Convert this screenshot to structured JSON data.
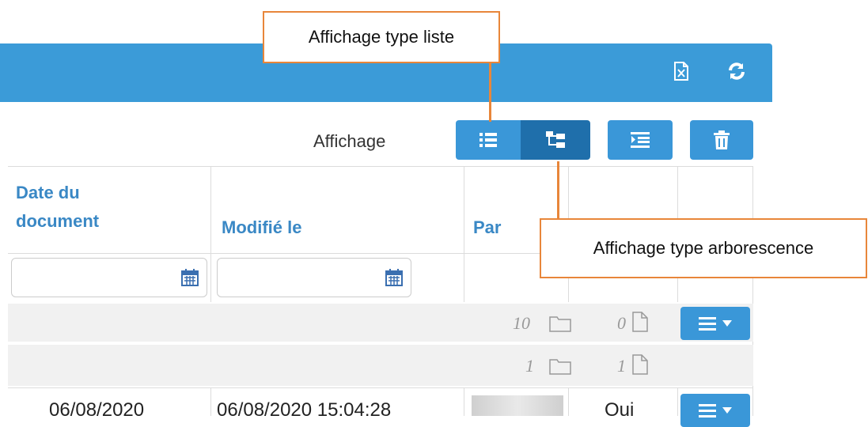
{
  "toolbar": {
    "display_label": "Affichage"
  },
  "header_icons": [
    "export-excel-icon",
    "refresh-icon"
  ],
  "columns": {
    "date_document": "Date du\ndocument",
    "modified": "Modifié le",
    "by": "Par"
  },
  "group_rows": [
    {
      "folders": "10",
      "files": "0"
    },
    {
      "folders": "1",
      "files": "1"
    }
  ],
  "row": {
    "date_document": "06/08/2020",
    "modified": "06/08/2020 15:04:28",
    "flag": "Oui"
  },
  "callouts": {
    "list_view": "Affichage type liste",
    "tree_view": "Affichage type arborescence"
  },
  "colors": {
    "header": "#3b9bd8",
    "button": "#3a97d8",
    "button_active": "#1f6fab",
    "callout_border": "#e8863a",
    "column_title": "#3a88c5"
  }
}
